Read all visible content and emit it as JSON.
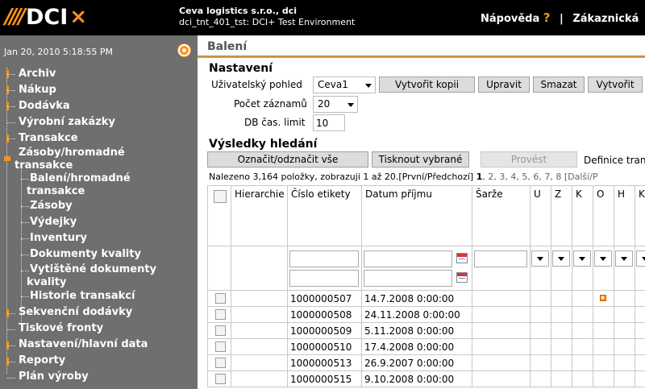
{
  "header": {
    "logo_text": "DCI",
    "company_name": "Ceva logistics s.r.o., dci",
    "environment": "dci_tnt_401_tst: DCI+ Test Environment",
    "help_label": "Nápověda",
    "help_mark": "?",
    "separator": "|",
    "customer_label": "Zákaznická"
  },
  "sidebar": {
    "datetime": "Jan 20, 2010 5:18:55 PM",
    "items": [
      {
        "label": "Archiv"
      },
      {
        "label": "Nákup"
      },
      {
        "label": "Dodávka"
      },
      {
        "label": "Výrobní zakázky"
      },
      {
        "label": "Transakce"
      },
      {
        "label": "Zásoby/hromadné transakce",
        "label_line1": "Zásoby/hromadné",
        "label_line2": "transakce"
      },
      {
        "label": "Balení/hromadné transakce",
        "label_line1": "Balení/hromadné",
        "label_line2": "transakce"
      },
      {
        "label": "Zásoby"
      },
      {
        "label": "Výdejky"
      },
      {
        "label": "Inventury"
      },
      {
        "label": "Dokumenty kvality"
      },
      {
        "label": "Vytištěné dokumenty kvality",
        "label_line1": "Vytištěné dokumenty",
        "label_line2": "kvality"
      },
      {
        "label": "Historie transakcí"
      },
      {
        "label": "Sekvenční dodávky"
      },
      {
        "label": "Tiskové fronty"
      },
      {
        "label": "Nastavení/hlavní data"
      },
      {
        "label": "Reporty"
      },
      {
        "label": "Plán výroby"
      }
    ]
  },
  "main": {
    "page_title": "Balení",
    "settings": {
      "title": "Nastavení",
      "view_label": "Uživatelský pohled",
      "view_value": "Ceva1",
      "copy_button": "Vytvořit kopii",
      "edit_button": "Upravit",
      "delete_button": "Smazat",
      "create_button": "Vytvořit",
      "records_label": "Počet záznamů",
      "records_value": "20",
      "db_limit_label": "DB čas. limit",
      "db_limit_value": "10"
    },
    "results": {
      "title": "Výsledky hledání",
      "toggle_button": "Označit/odznačit vše",
      "print_button": "Tisknout vybrané",
      "execute_button": "Provést",
      "definition_label": "Definice tran",
      "status_text": "Nalezeno 3,164 položky, zobrazuji 1 až 20.[První/Předchozí]",
      "pages": [
        "1",
        "2",
        "3",
        "4",
        "5",
        "6",
        "7",
        "8"
      ],
      "next_text": "[Další/P"
    },
    "table": {
      "columns": [
        "Hierarchie",
        "Číslo etikety",
        "Datum příjmu",
        "Šarže",
        "U",
        "Z",
        "K",
        "O",
        "H",
        "K"
      ],
      "rows": [
        {
          "label_no": "1000000507",
          "date": "14.7.2008 0:00:00",
          "flag_o": true
        },
        {
          "label_no": "1000000508",
          "date": "24.11.2008 0:00:00",
          "flag_o": false
        },
        {
          "label_no": "1000000509",
          "date": "5.11.2008 0:00:00",
          "flag_o": false
        },
        {
          "label_no": "1000000510",
          "date": "17.4.2008 0:00:00",
          "flag_o": false
        },
        {
          "label_no": "1000000513",
          "date": "26.9.2007 0:00:00",
          "flag_o": false
        },
        {
          "label_no": "1000000515",
          "date": "9.10.2008 0:00:00",
          "flag_o": false
        }
      ]
    }
  }
}
